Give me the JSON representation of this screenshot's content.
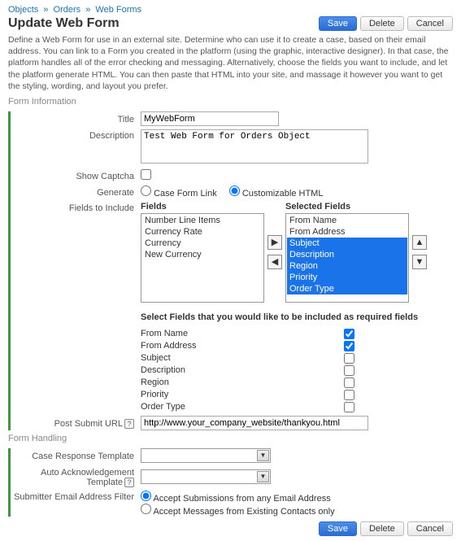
{
  "breadcrumb": {
    "items": [
      "Objects",
      "Orders",
      "Web Forms"
    ]
  },
  "header": {
    "title": "Update Web Form",
    "buttons": {
      "save": "Save",
      "delete": "Delete",
      "cancel": "Cancel"
    }
  },
  "intro": "Define a Web Form for use in an external site. Determine who can use it to create a case, based on their email address. You can link to a Form you created in the platform (using the graphic, interactive designer). In that case, the platform handles all of the error checking and messaging. Alternatively, choose the fields you want to include, and let the platform generate HTML. You can then paste that HTML into your site, and massage it however you want to get the styling, wording, and layout you prefer.",
  "sections": {
    "form_info": "Form Information",
    "form_handling": "Form Handling"
  },
  "labels": {
    "title": "Title",
    "description": "Description",
    "show_captcha": "Show Captcha",
    "generate": "Generate",
    "fields_to_include": "Fields to Include",
    "post_submit_url": "Post Submit URL",
    "case_response_template": "Case Response Template",
    "auto_ack_template": "Auto Acknowledgement Template",
    "submitter_filter": "Submitter Email Address Filter"
  },
  "values": {
    "title": "MyWebForm",
    "description": "Test Web Form for Orders Object",
    "show_captcha": false,
    "generate": "customizable_html",
    "post_submit_url": "http://www.your_company_website/thankyou.html",
    "submitter_filter": "any"
  },
  "generate_options": {
    "case_form_link": "Case Form Link",
    "customizable_html": "Customizable HTML"
  },
  "fields_area": {
    "fields_header": "Fields",
    "selected_header": "Selected Fields",
    "available": [
      "Number Line Items",
      "Currency Rate",
      "Currency",
      "New Currency"
    ],
    "selected": [
      {
        "label": "From Name",
        "selected": false
      },
      {
        "label": "From Address",
        "selected": false
      },
      {
        "label": "Subject",
        "selected": true
      },
      {
        "label": "Description",
        "selected": true
      },
      {
        "label": "Region",
        "selected": true
      },
      {
        "label": "Priority",
        "selected": true
      },
      {
        "label": "Order Type",
        "selected": true
      }
    ],
    "note": "Select Fields that you would like to be included as required fields",
    "required": [
      {
        "label": "From Name",
        "checked": true
      },
      {
        "label": "From Address",
        "checked": true
      },
      {
        "label": "Subject",
        "checked": false
      },
      {
        "label": "Description",
        "checked": false
      },
      {
        "label": "Region",
        "checked": false
      },
      {
        "label": "Priority",
        "checked": false
      },
      {
        "label": "Order Type",
        "checked": false
      }
    ]
  },
  "submitter_options": {
    "any": "Accept Submissions from any Email Address",
    "existing": "Accept Messages from Existing Contacts only"
  },
  "help_glyph": "?"
}
